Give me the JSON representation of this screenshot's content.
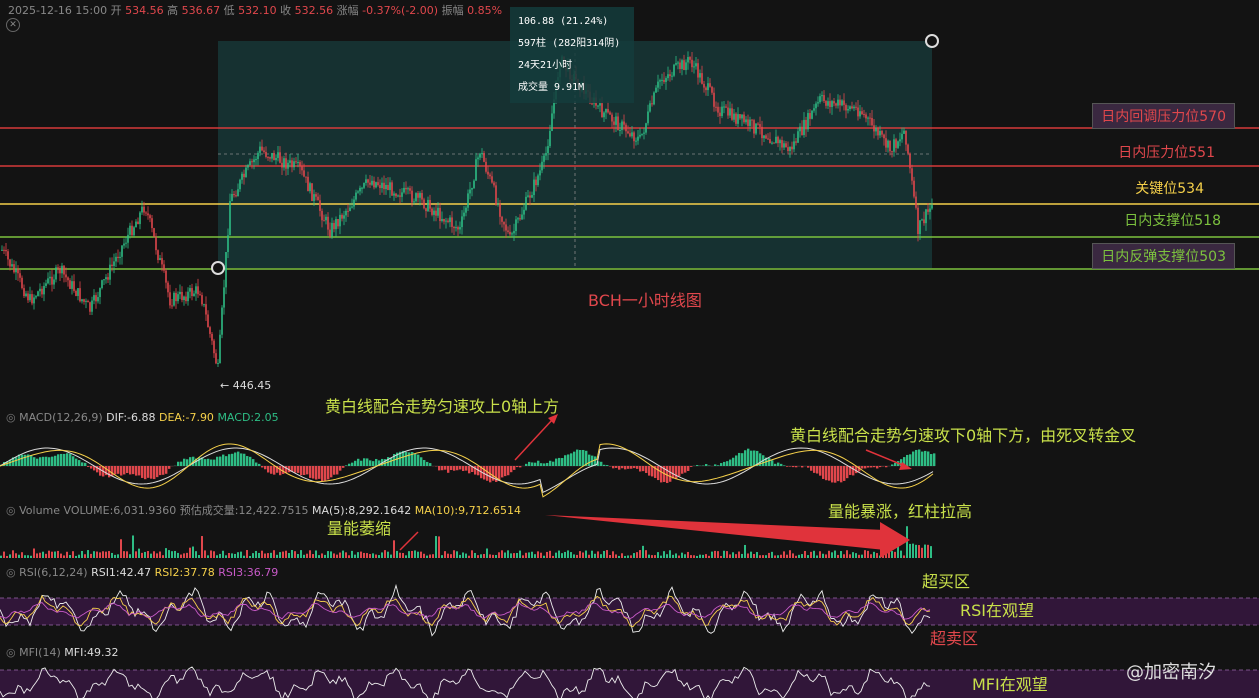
{
  "header": {
    "datetime": "2025-12-16 15:00",
    "open_label": "开",
    "open_value": "534.56",
    "high_label": "高",
    "high_value": "536.67",
    "low_label": "低",
    "low_value": "532.10",
    "close_label": "收",
    "close_value": "532.56",
    "change_label": "涨幅",
    "change_value": "-0.37%(-2.00)",
    "amplitude_label": "振幅",
    "amplitude_value": "0.85%"
  },
  "info_box": {
    "line1": "106.88 (21.24%)",
    "line2": "597柱 (282阳314阴)",
    "line3": "24天21小时",
    "line4": "成交量 9.91M"
  },
  "levels": {
    "l570": "日内回调压力位570",
    "l551": "日内压力位551",
    "l534": "关键位534",
    "l518": "日内支撑位518",
    "l503": "日内反弹支撑位503"
  },
  "chart_title": "BCH一小时线图",
  "low_marker": "← 446.45",
  "macd": {
    "name": "MACD(12,26,9)",
    "dif": "DIF:-6.88",
    "dea": "DEA:-7.90",
    "macd": "MACD:2.05"
  },
  "volume": {
    "name": "Volume",
    "volume": "VOLUME:6,031.9360",
    "est": "预估成交量:12,422.7515",
    "ma5": "MA(5):8,292.1642",
    "ma10": "MA(10):9,712.6514"
  },
  "rsi": {
    "name": "RSI(6,12,24)",
    "rsi1": "RSI1:42.47",
    "rsi2": "RSI2:37.78",
    "rsi3": "RSI3:36.79"
  },
  "mfi": {
    "name": "MFI(14)",
    "mfi": "MFI:49.32"
  },
  "annotations": {
    "macd_up": "黄白线配合走势匀速攻上0轴上方",
    "macd_down": "黄白线配合走势匀速攻下0轴下方，由死叉转金叉",
    "vol_shrink": "量能萎缩",
    "vol_surge": "量能暴涨，红柱拉高",
    "overbought": "超买区",
    "rsi_watch": "RSI在观望",
    "oversold": "超卖区",
    "mfi_watch": "MFI在观望"
  },
  "watermark_brand": "@加密南汐",
  "colors": {
    "up": "#2ebd85",
    "down": "#e0474c",
    "level_red": "#d63b3b",
    "level_yellow": "#f5d04a",
    "level_green": "#7cc23e"
  }
}
